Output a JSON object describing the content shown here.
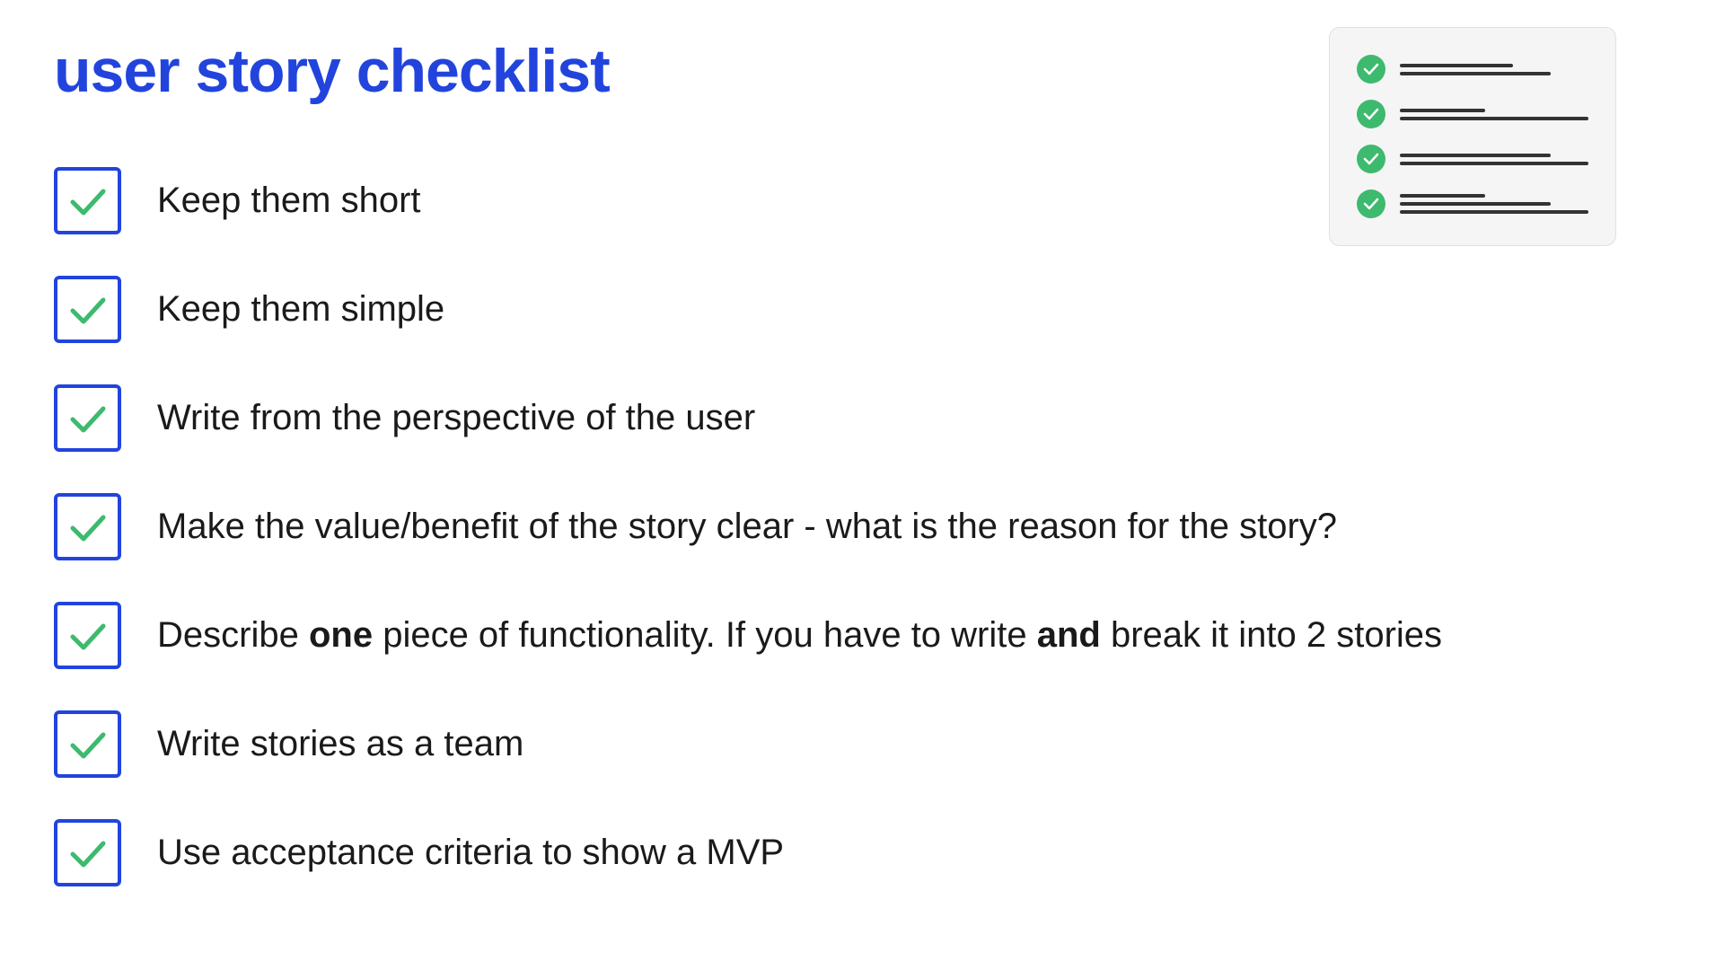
{
  "page": {
    "title": "user story checklist",
    "title_color": "#2244dd",
    "background": "#ffffff"
  },
  "checklist": {
    "items": [
      {
        "id": 1,
        "text_plain": "Keep them short",
        "text_html": "Keep them short",
        "has_bold": false
      },
      {
        "id": 2,
        "text_plain": "Keep them simple",
        "text_html": "Keep them simple",
        "has_bold": false
      },
      {
        "id": 3,
        "text_plain": "Write from the perspective of the user",
        "text_html": "Write from the perspective of the user",
        "has_bold": false
      },
      {
        "id": 4,
        "text_plain": "Make the value/benefit of the story clear - what is the reason for the story?",
        "text_html": "Make the value/benefit of the story clear - what is the reason for the story?",
        "has_bold": false
      },
      {
        "id": 5,
        "text_plain": "Describe one piece of functionality. If you have to write and break it into 2 stories",
        "text_html": "Describe <strong>one</strong> piece of functionality. If you have to write <strong>and</strong> break it into 2 stories",
        "has_bold": true
      },
      {
        "id": 6,
        "text_plain": "Write stories as a team",
        "text_html": "Write stories as a team",
        "has_bold": false
      },
      {
        "id": 7,
        "text_plain": "Use acceptance criteria to show a MVP",
        "text_html": "Use acceptance criteria to show a MVP",
        "has_bold": false
      }
    ]
  },
  "mini_checklist": {
    "items": [
      {
        "lines": [
          "short",
          "medium"
        ]
      },
      {
        "lines": [
          "xshort",
          "long"
        ]
      },
      {
        "lines": [
          "medium",
          "long"
        ]
      },
      {
        "lines": [
          "xshort",
          "medium",
          "long"
        ]
      }
    ]
  },
  "icons": {
    "checkmark": "✓",
    "check_circle": "✓"
  },
  "colors": {
    "title": "#2244dd",
    "checkbox_border": "#2244dd",
    "checkmark": "#3dba6e",
    "text": "#1a1a1a",
    "mini_check": "#3dba6e",
    "mini_line": "#333333",
    "card_bg": "#f5f5f5",
    "card_border": "#e0e0e0"
  }
}
